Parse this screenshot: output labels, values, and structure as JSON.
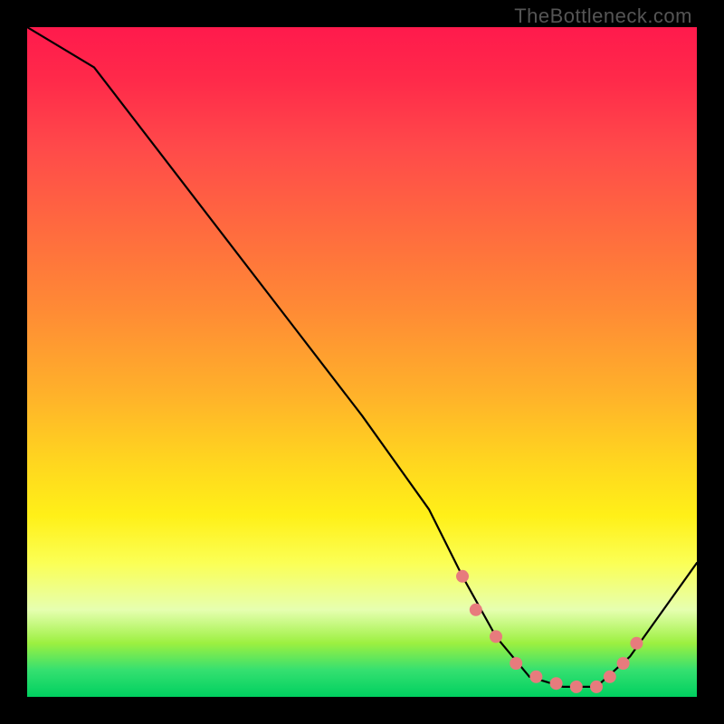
{
  "watermark": "TheBottleneck.com",
  "chart_data": {
    "type": "line",
    "title": "",
    "xlabel": "",
    "ylabel": "",
    "xlim": [
      0,
      100
    ],
    "ylim": [
      0,
      100
    ],
    "series": [
      {
        "name": "curve",
        "x": [
          0,
          5,
          10,
          20,
          30,
          40,
          50,
          60,
          65,
          70,
          75,
          80,
          85,
          90,
          100
        ],
        "y": [
          100,
          97,
          94,
          81,
          68,
          55,
          42,
          28,
          18,
          9,
          3,
          1.5,
          1.5,
          6,
          20
        ]
      }
    ],
    "markers": {
      "name": "dots",
      "color": "#e77b7d",
      "x": [
        65,
        67,
        70,
        73,
        76,
        79,
        82,
        85,
        87,
        89,
        91
      ],
      "y": [
        18,
        13,
        9,
        5,
        3,
        2,
        1.5,
        1.5,
        3,
        5,
        8
      ]
    }
  }
}
